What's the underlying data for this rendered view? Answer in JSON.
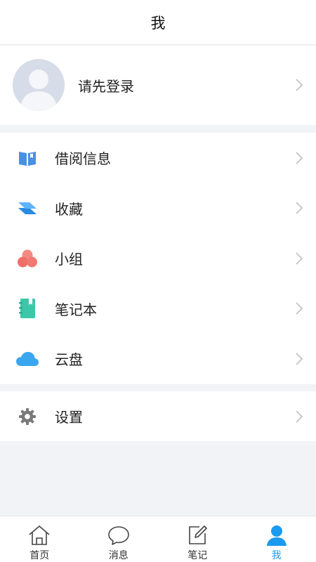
{
  "header": {
    "title": "我"
  },
  "profile": {
    "login_prompt": "请先登录",
    "avatar_icon": "user-silhouette-icon"
  },
  "menu": {
    "items": [
      {
        "label": "借阅信息",
        "icon": "book-icon",
        "color": "#4a90e2"
      },
      {
        "label": "收藏",
        "icon": "layers-icon",
        "color": "#2a8be0"
      },
      {
        "label": "小组",
        "icon": "group-icon",
        "color": "#f07a72"
      },
      {
        "label": "笔记本",
        "icon": "notebook-icon",
        "color": "#3cc8a8"
      },
      {
        "label": "云盘",
        "icon": "cloud-icon",
        "color": "#3aa6f0"
      }
    ]
  },
  "settings": {
    "label": "设置",
    "icon": "gear-icon",
    "color": "#7a7a7a"
  },
  "tabbar": {
    "tabs": [
      {
        "label": "首页",
        "icon": "home-icon"
      },
      {
        "label": "消息",
        "icon": "message-icon"
      },
      {
        "label": "笔记",
        "icon": "edit-note-icon"
      },
      {
        "label": "我",
        "icon": "person-icon",
        "active": true
      }
    ],
    "active_color": "#1b9af0"
  }
}
